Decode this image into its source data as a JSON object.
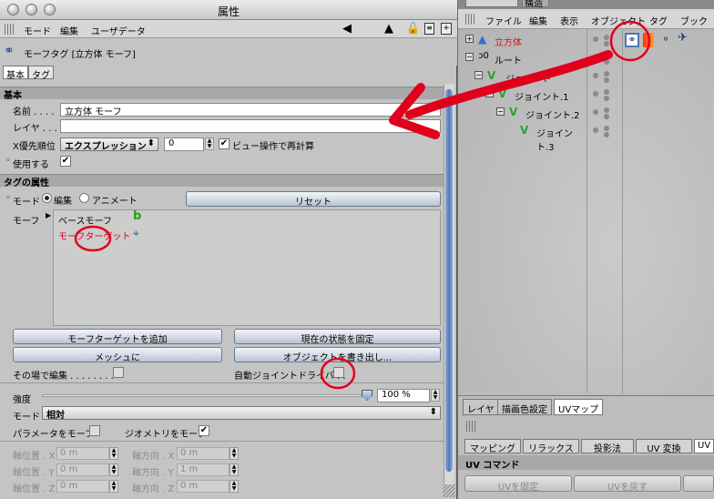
{
  "window": {
    "title": "属性"
  },
  "menu": {
    "mode": "モード",
    "edit": "編集",
    "userdata": "ユーザデータ"
  },
  "tag": {
    "title": "モーフタグ [立方体 モーフ]",
    "tabs": [
      "基本",
      "タグ"
    ]
  },
  "basic": {
    "section": "基本",
    "name_label": "名前 . . . .",
    "name_value": "立方体 モーフ",
    "layer_label": "レイヤ . . .",
    "layer_value": "",
    "xpriority_label": "X優先順位",
    "xpriority_value": "エクスプレッション",
    "xpriority_num": "0",
    "viewcalc_label": "ビュー操作で再計算",
    "enable_label": "使用する"
  },
  "tagprops": {
    "section": "タグの属性",
    "mode_label": "モード",
    "edit_label": "編集",
    "anim_label": "アニメート",
    "reset": "リセット",
    "morph_label": "モーフ",
    "morphs": [
      "ベースモーフ",
      "モーフターゲット"
    ],
    "add_target": "モーフターゲットを追加",
    "fix_state": "現在の状態を固定",
    "to_mesh": "メッシュに",
    "export_obj": "オブジェクトを書き出し...",
    "edit_inplace": "その場で編集 . . . . . . . .",
    "auto_joint": "自動ジョイントドライバ . .",
    "strength_label": "強度",
    "strength_value": "100 %",
    "mode2_label": "モード",
    "mode2_value": "相対",
    "param_morph": "パラメータをモーフ",
    "geo_morph": "ジオメトリをモーフ",
    "axis_pos": [
      {
        "label": "軸位置 . X",
        "value": "0 m"
      },
      {
        "label": "軸位置 . Y",
        "value": "0 m"
      },
      {
        "label": "軸位置 . Z",
        "value": "0 m"
      }
    ],
    "axis_dir": [
      {
        "label": "軸方向 . X",
        "value": "0 m"
      },
      {
        "label": "軸方向 . Y",
        "value": "1 m"
      },
      {
        "label": "軸方向 . Z",
        "value": "0 m"
      }
    ]
  },
  "objects": {
    "menu": [
      "ファイル",
      "編集",
      "表示",
      "オブジェクト",
      "タグ",
      "ブック"
    ],
    "tabs_top": [
      "",
      "構造"
    ],
    "items": [
      {
        "name": "立方体",
        "depth": 0,
        "color": "#d01818"
      },
      {
        "name": "ルート",
        "depth": 0,
        "color": "#000000"
      },
      {
        "name": "ジョイント",
        "depth": 1,
        "color": "#000000"
      },
      {
        "name": "ジョイント.1",
        "depth": 2,
        "color": "#000000"
      },
      {
        "name": "ジョイント.2",
        "depth": 3,
        "color": "#000000"
      },
      {
        "name": "ジョイント.3",
        "depth": 4,
        "color": "#000000"
      }
    ]
  },
  "bottom": {
    "tabs": [
      "レイヤ",
      "描画色設定",
      "UVマップ"
    ],
    "uvtabs": [
      "マッピング",
      "リラックスUV",
      "投影法",
      "UV 変換",
      "UV"
    ],
    "uvcmd": "UV コマンド",
    "uvbtns": [
      "UVを固定",
      "UVを戻す"
    ]
  },
  "colors": {
    "accent": "#e0001c",
    "selected": "#4c78b4"
  }
}
